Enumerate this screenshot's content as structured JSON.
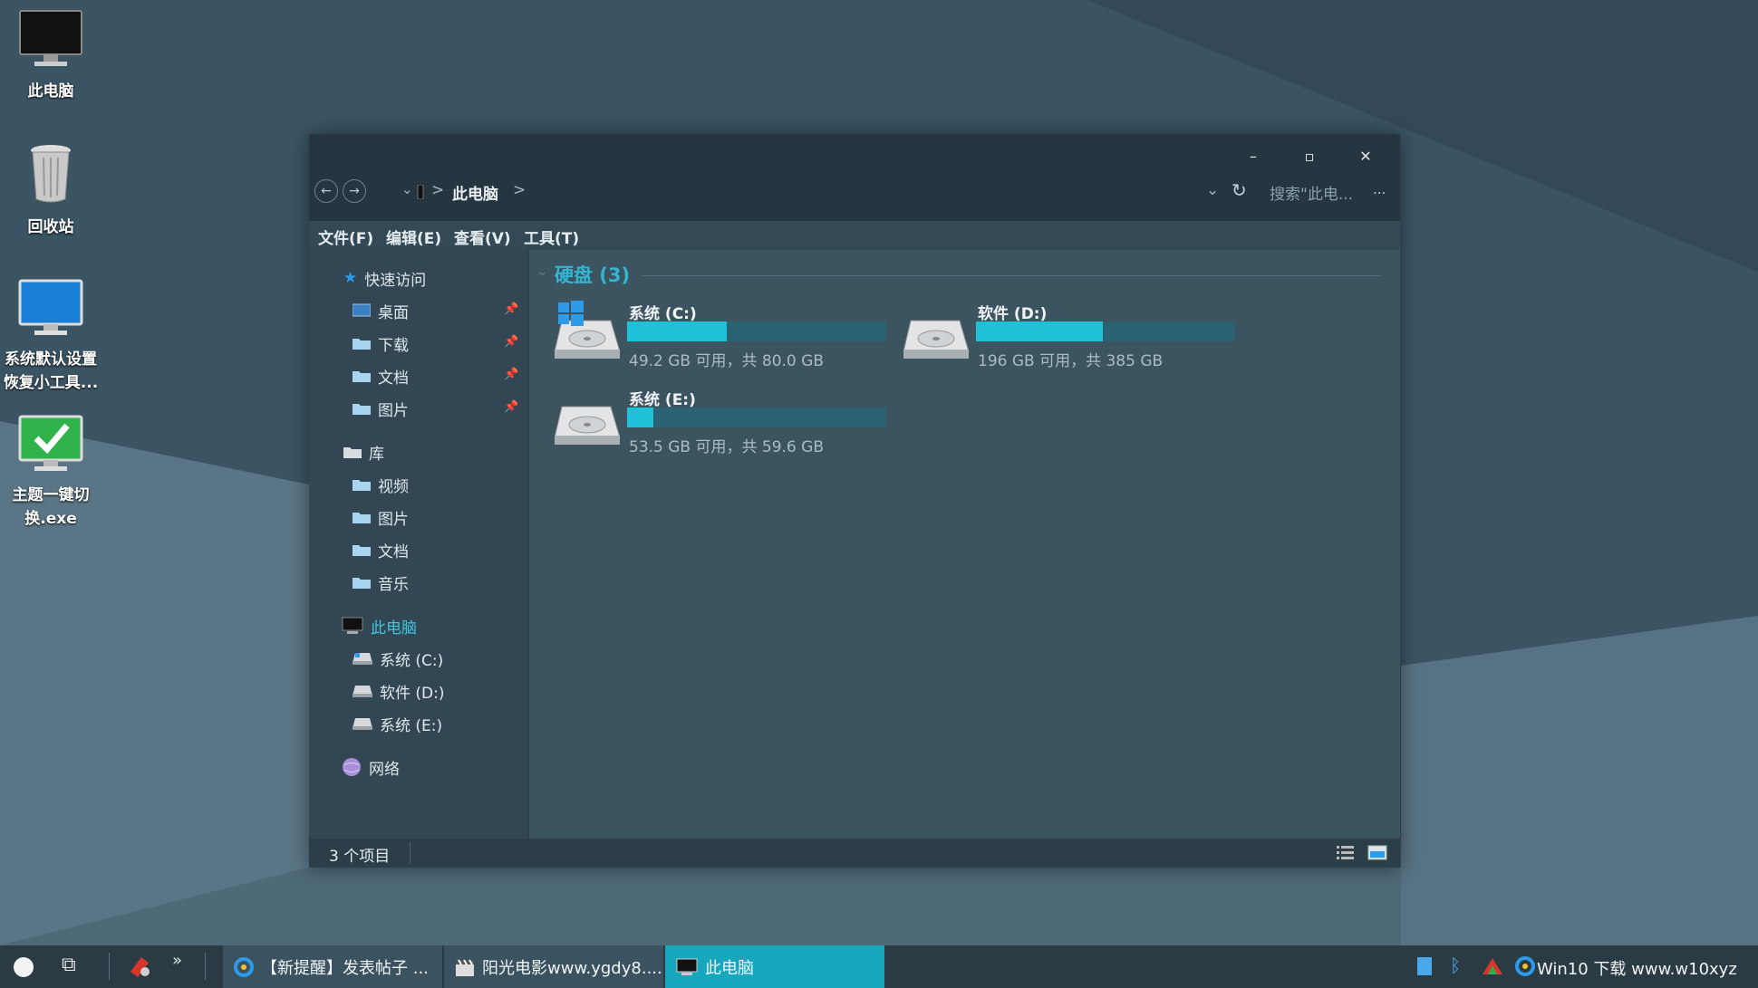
{
  "desktop": {
    "icons": [
      {
        "label": "此电脑"
      },
      {
        "label": "回收站"
      },
      {
        "label_line1": "系统默认设置",
        "label_line2": "恢复小工具..."
      },
      {
        "label_line1": "主题一键切",
        "label_line2": "换.exe"
      }
    ]
  },
  "window": {
    "controls": {
      "minimize": "–",
      "maximize": "▫",
      "close": "✕"
    },
    "nav": {
      "back": "←",
      "forward": "→"
    },
    "breadcrumb": {
      "location": "此电脑",
      "sep": ">"
    },
    "search_placeholder": "搜索\"此电...",
    "more": "...",
    "refresh": "↻",
    "dropdown": "⌄",
    "menu": [
      "文件(F)",
      "编辑(E)",
      "查看(V)",
      "工具(T)"
    ],
    "sidebar": {
      "quick_access": "快速访问",
      "quick_items": [
        "桌面",
        "下载",
        "文档",
        "图片"
      ],
      "library": "库",
      "library_items": [
        "视频",
        "图片",
        "文档",
        "音乐"
      ],
      "this_pc": "此电脑",
      "drives": [
        "系统 (C:)",
        "软件 (D:)",
        "系统 (E:)"
      ],
      "network": "网络"
    },
    "content": {
      "group_title": "硬盘 (3)",
      "drives": [
        {
          "name": "系统 (C:)",
          "info": "49.2 GB 可用，共 80.0 GB",
          "used_fraction": 0.385
        },
        {
          "name": "软件 (D:)",
          "info": "196 GB 可用，共 385 GB",
          "used_fraction": 0.491
        },
        {
          "name": "系统 (E:)",
          "info": "53.5 GB 可用，共 59.6 GB",
          "used_fraction": 0.102
        }
      ]
    },
    "status": "3 个项目"
  },
  "taskbar": {
    "items": [
      "【新提醒】发表帖子 ...",
      "阳光电影www.ygdy8....",
      "此电脑"
    ],
    "tray_text": "Win10 下载 www.w10xyz"
  },
  "colors": {
    "accent": "#1ec1d8",
    "window_bg": "#2f424d"
  }
}
